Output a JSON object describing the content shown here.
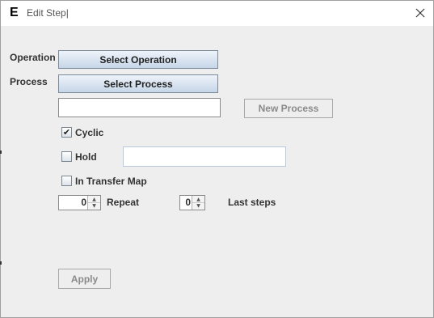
{
  "window": {
    "title": "Edit Step|",
    "app_icon_letter": "E"
  },
  "labels": {
    "operation": "Operation",
    "process": "Process"
  },
  "buttons": {
    "select_operation": "Select Operation",
    "select_process": "Select Process",
    "new_process": "New Process",
    "apply": "Apply"
  },
  "fields": {
    "process_name_value": "",
    "hold_value": ""
  },
  "checkboxes": {
    "cyclic": {
      "label": "Cyclic",
      "checked": true,
      "mark": "✔"
    },
    "hold": {
      "label": "Hold",
      "checked": false
    },
    "in_transfer_map": {
      "label": "In Transfer Map",
      "checked": false
    }
  },
  "spinners": {
    "repeat": {
      "value": "0",
      "label": "Repeat"
    },
    "last_steps": {
      "value": "0",
      "label": "Last steps"
    }
  },
  "icons": {
    "close": "close-icon",
    "spin_up": "▲",
    "spin_down": "▼"
  }
}
